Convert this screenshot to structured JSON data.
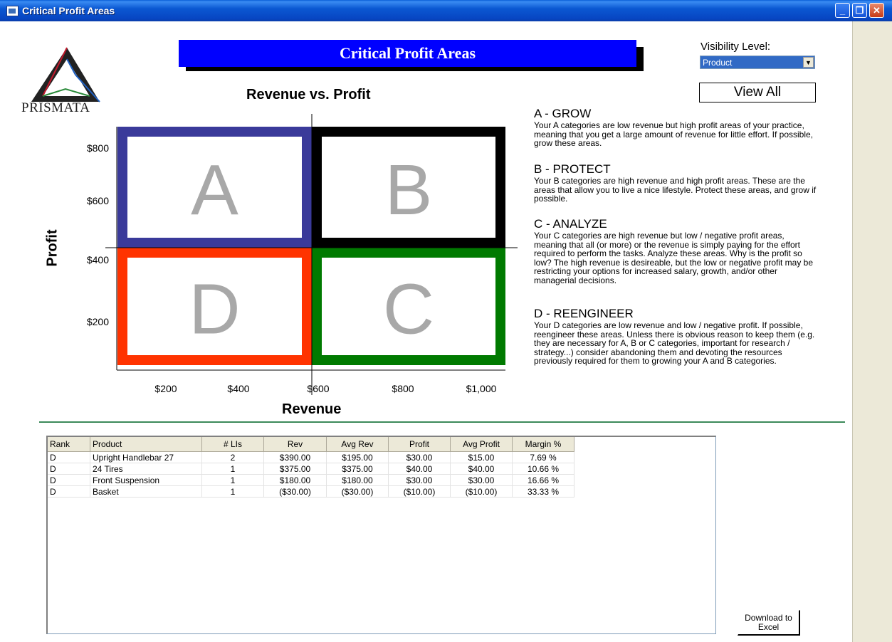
{
  "window": {
    "title": "Critical Profit Areas"
  },
  "logo": {
    "text": "PRISMATA"
  },
  "header": {
    "banner": "Critical Profit Areas"
  },
  "visibility": {
    "label": "Visibility Level:",
    "selected": "Product"
  },
  "view_all_label": "View All",
  "chart_data": {
    "type": "quadrant",
    "title": "Revenue vs. Profit",
    "xlabel": "Revenue",
    "ylabel": "Profit",
    "x_ticks": [
      "$200",
      "$400",
      "$600",
      "$800",
      "$1,000"
    ],
    "y_ticks": [
      "$800",
      "$600",
      "$400",
      "$200"
    ],
    "quadrants": [
      {
        "letter": "A",
        "position": "top-left",
        "color": "#3a3a9a"
      },
      {
        "letter": "B",
        "position": "top-right",
        "color": "#000000"
      },
      {
        "letter": "D",
        "position": "bottom-left",
        "color": "#ff3300"
      },
      {
        "letter": "C",
        "position": "bottom-right",
        "color": "#007a00"
      }
    ],
    "letter_color": "#a8a8a8"
  },
  "descriptions": [
    {
      "heading": "A - GROW",
      "text": "Your A categories are low revenue but high profit areas of your practice, meaning that you get a large amount of revenue for little effort.  If possible, grow these areas."
    },
    {
      "heading": "B - PROTECT",
      "text": "Your B categories are high revenue and high profit areas.  These are the areas that allow you to live a nice lifestyle.  Protect these areas, and grow if possible."
    },
    {
      "heading": "C - ANALYZE",
      "text": "Your C categories are high revenue but low / negative profit areas, meaning that all (or more) or the revenue is simply paying for the effort required to perform the tasks.  Analyze these areas.  Why is the profit so low?  The high revenue is desireable, but the low or negative profit may be restricting your options for increased salary, growth, and/or other managerial decisions."
    },
    {
      "heading": "D - REENGINEER",
      "text": "Your D categories are low revenue and low / negative profit.  If possible, reengineer these areas.  Unless there is obvious reason to keep them (e.g. they are necessary for A, B or C categories,  important for research / strategy...) consider abandoning them and devoting the resources previously required for them to growing your A and B categories."
    }
  ],
  "table": {
    "columns": [
      "Rank",
      "Product",
      "# LIs",
      "Rev",
      "Avg Rev",
      "Profit",
      "Avg Profit",
      "Margin %"
    ],
    "rows": [
      [
        "D",
        "Upright Handlebar 27",
        "2",
        "$390.00",
        "$195.00",
        "$30.00",
        "$15.00",
        "7.69 %"
      ],
      [
        "D",
        "24 Tires",
        "1",
        "$375.00",
        "$375.00",
        "$40.00",
        "$40.00",
        "10.66 %"
      ],
      [
        "D",
        "Front Suspension",
        "1",
        "$180.00",
        "$180.00",
        "$30.00",
        "$30.00",
        "16.66 %"
      ],
      [
        "D",
        "Basket",
        "1",
        "($30.00)",
        "($30.00)",
        "($10.00)",
        "($10.00)",
        "33.33 %"
      ]
    ]
  },
  "download_label_line1": "Download to",
  "download_label_line2": "Excel"
}
